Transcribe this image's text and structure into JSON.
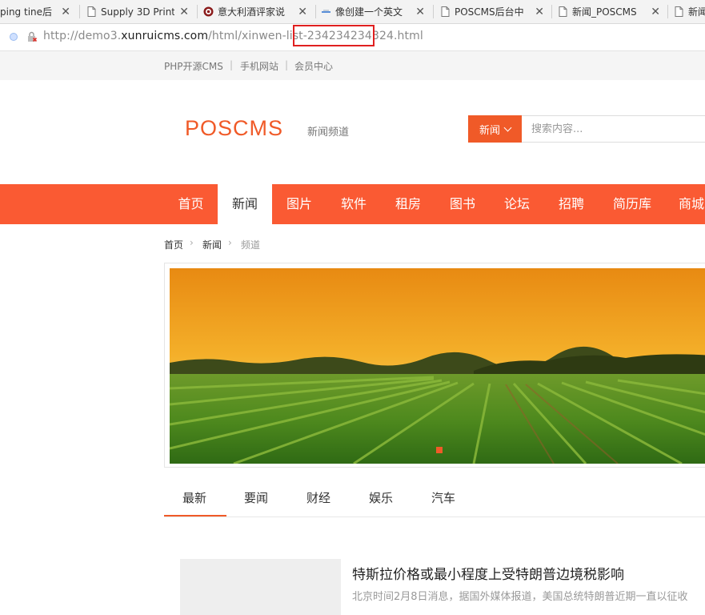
{
  "browser": {
    "tabs": [
      {
        "title": "ping tine后",
        "icon": "none"
      },
      {
        "title": "Supply 3D Print",
        "icon": "document-icon"
      },
      {
        "title": "意大利酒评家说",
        "icon": "red-badge-icon"
      },
      {
        "title": "像创建一个英文",
        "icon": "link-icon"
      },
      {
        "title": "POSCMS后台中",
        "icon": "document-icon"
      },
      {
        "title": "新闻_POSCMS",
        "icon": "document-icon"
      },
      {
        "title": "新闻",
        "icon": "document-icon"
      }
    ],
    "url": {
      "prefix": "http://demo3.",
      "host": "xunruicms.com",
      "path_a": "/html/xinwen-list-",
      "highlight": "234234234324",
      "path_b": ".html"
    }
  },
  "toplinks": [
    "PHP开源CMS",
    "手机网站",
    "会员中心"
  ],
  "header": {
    "logo": "POSCMS",
    "channel": "新闻频道",
    "search_select": "新闻",
    "search_placeholder": "搜索内容..."
  },
  "nav": [
    "首页",
    "新闻",
    "图片",
    "软件",
    "租房",
    "图书",
    "论坛",
    "招聘",
    "简历库",
    "商城"
  ],
  "nav_active_index": 1,
  "breadcrumb": [
    "首页",
    "新闻",
    "频道"
  ],
  "subtabs": [
    "最新",
    "要闻",
    "财经",
    "娱乐",
    "汽车"
  ],
  "article": {
    "title": "特斯拉价格或最小程度上受特朗普边境税影响",
    "summary": "北京时间2月8日消息，据国外媒体报道，美国总统特朗普近期一直以征收"
  },
  "colors": {
    "brand": "#f05a28",
    "nav_bg": "#fa5a33",
    "highlight_box": "#e02020"
  }
}
